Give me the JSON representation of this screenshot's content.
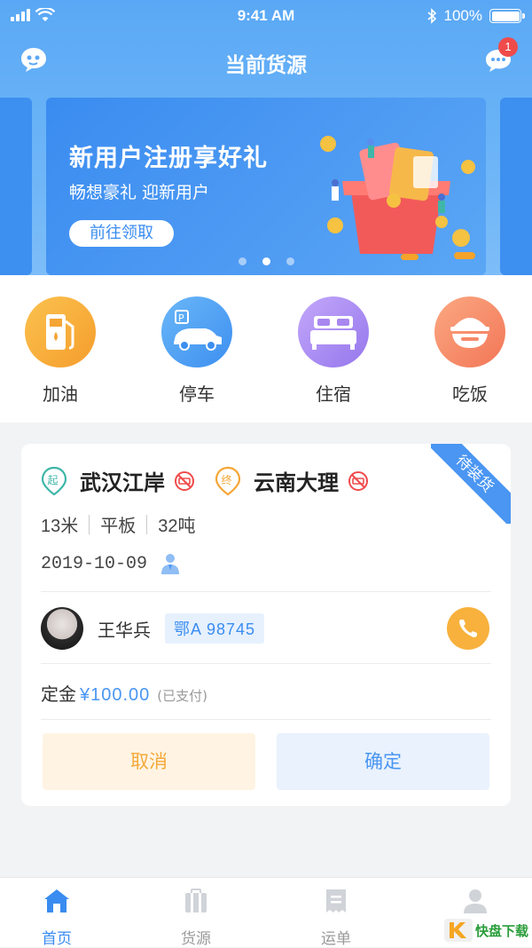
{
  "status_bar": {
    "time": "9:41 AM",
    "battery": "100%"
  },
  "nav": {
    "title": "当前货源",
    "badge_count": "1"
  },
  "banner": {
    "title": "新用户注册享好礼",
    "subtitle": "畅想豪礼 迎新用户",
    "button": "前往领取",
    "active_dot": 2,
    "dot_count": 3
  },
  "services": [
    {
      "label": "加油",
      "icon": "gas-station-icon",
      "color": "#f7a93a"
    },
    {
      "label": "停车",
      "icon": "car-parking-icon",
      "color": "#4a9ef5"
    },
    {
      "label": "住宿",
      "icon": "bed-icon",
      "color": "#a987f0"
    },
    {
      "label": "吃饭",
      "icon": "food-bowl-icon",
      "color": "#f58a6a"
    }
  ],
  "order": {
    "status": "待装货",
    "origin_tag": "起",
    "origin": "武汉江岸",
    "dest_tag": "终",
    "destination": "云南大理",
    "length": "13米",
    "truck_type": "平板",
    "weight": "32吨",
    "date": "2019-10-09",
    "driver_name": "王华兵",
    "plate": "鄂A 98745",
    "deposit_label": "定金",
    "deposit_amount": "¥100.00",
    "deposit_note": "(已支付)",
    "cancel_label": "取消",
    "confirm_label": "确定"
  },
  "tabbar": {
    "items": [
      {
        "label": "首页",
        "icon": "home-icon",
        "active": true
      },
      {
        "label": "货源",
        "icon": "cargo-icon",
        "active": false
      },
      {
        "label": "运单",
        "icon": "waybill-icon",
        "active": false
      },
      {
        "label": "",
        "icon": "profile-icon",
        "active": false
      }
    ]
  },
  "watermark": {
    "text": "快盘下载"
  },
  "colors": {
    "primary": "#4a96f2",
    "warning": "#f7b13c",
    "danger": "#f04b4b"
  }
}
